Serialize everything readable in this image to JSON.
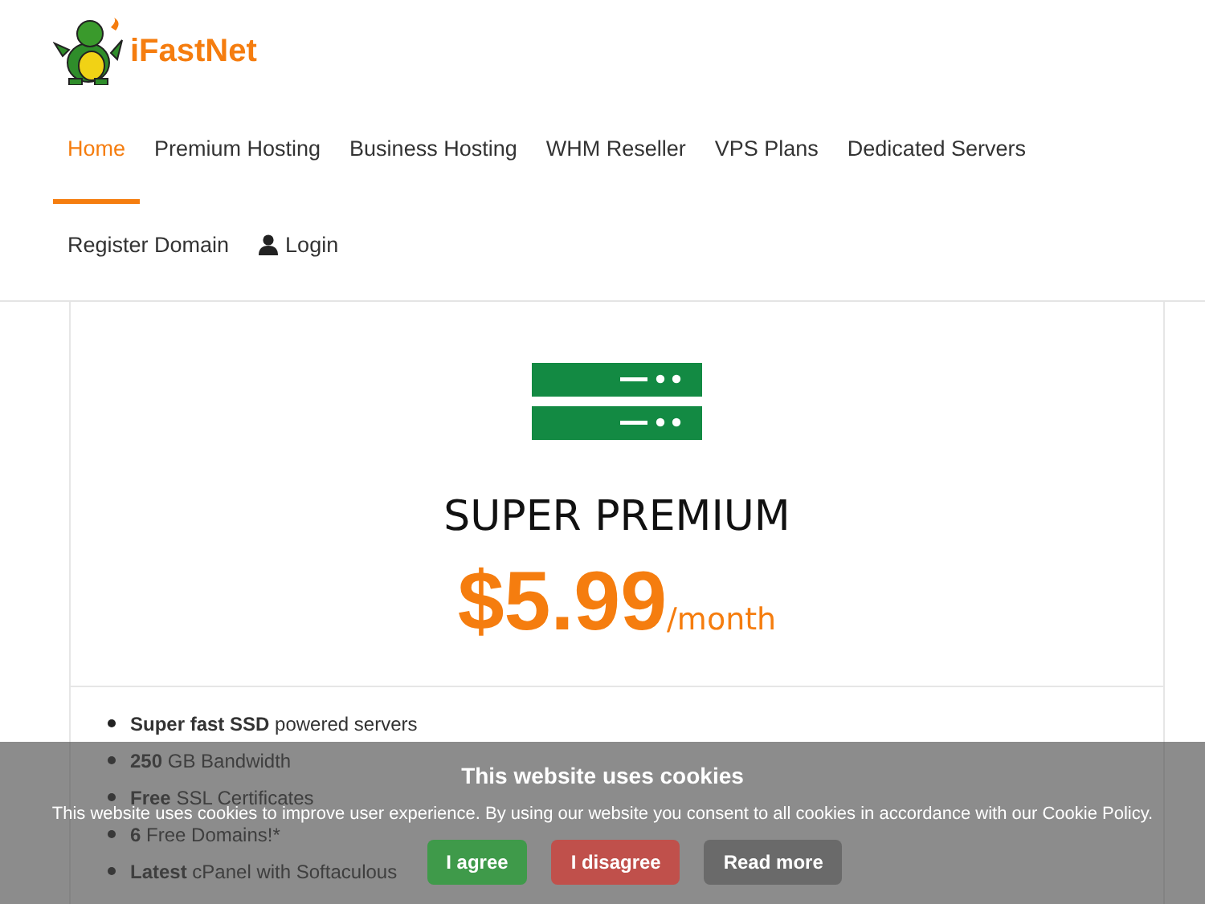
{
  "brand": {
    "name": "iFastNet"
  },
  "nav": [
    {
      "label": "Home",
      "selected": true
    },
    {
      "label": "Premium Hosting",
      "selected": false
    },
    {
      "label": "Business Hosting",
      "selected": false
    },
    {
      "label": "WHM Reseller",
      "selected": false
    },
    {
      "label": "VPS Plans",
      "selected": false
    },
    {
      "label": "Dedicated Servers",
      "selected": false
    },
    {
      "label": "Register Domain",
      "selected": false
    },
    {
      "label": "Login",
      "selected": false,
      "kind": "user"
    }
  ],
  "plan": {
    "title": "SUPER PREMIUM",
    "price": "$5.99",
    "period": "/month",
    "features": [
      "**Super fast SSD** powered servers",
      "**250** GB Bandwidth",
      "**Free** SSL Certificates",
      "**6** Free Domains!*",
      "**Latest** cPanel with Softaculous"
    ]
  },
  "cookie_banner": {
    "title": "This website uses cookies",
    "text": "This website uses cookies to improve user experience. By using our website you consent to all cookies in accordance with our Cookie Policy.",
    "buttons": [
      {
        "label": "I agree",
        "kind": "accept"
      },
      {
        "label": "I disagree",
        "kind": "decline"
      },
      {
        "label": "Read more",
        "kind": "info"
      }
    ]
  }
}
